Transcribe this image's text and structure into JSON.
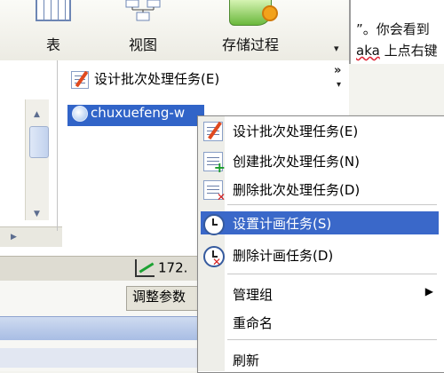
{
  "toolbar": {
    "buttons": [
      {
        "label": "表",
        "icon": "table-icon"
      },
      {
        "label": "视图",
        "icon": "view-icon"
      },
      {
        "label": "存储过程",
        "icon": "stored-procedure-icon"
      }
    ],
    "more": "▾",
    "overflow": "»"
  },
  "document": {
    "line1_a": "”。你会看到",
    "line2_a": "aka",
    "line2_b": " 上点右键"
  },
  "tree": {
    "design_task": "设计批次处理任务(E)",
    "selected_node": "chuxuefeng-w",
    "scroll_up": "▲",
    "scroll_down": "▼",
    "scroll_right": "▶"
  },
  "status": {
    "ip_text": "172."
  },
  "lower": {
    "tab_label": "调整参数"
  },
  "context_menu": {
    "items": [
      {
        "label": "设计批次处理任务(E)",
        "icon": "design-task-icon"
      },
      {
        "label": "创建批次处理任务(N)",
        "icon": "create-task-icon"
      },
      {
        "label": "删除批次处理任务(D)",
        "icon": "delete-task-icon"
      },
      {
        "label": "设置计画任务(S)",
        "icon": "schedule-icon",
        "highlighted": true
      },
      {
        "label": "删除计画任务(D)",
        "icon": "delete-schedule-icon"
      },
      {
        "label": "管理组",
        "submenu": "▶"
      },
      {
        "label": "重命名"
      },
      {
        "label": "刷新"
      }
    ]
  },
  "colors": {
    "highlight": "#3a68c9",
    "selection": "#3164c8"
  }
}
